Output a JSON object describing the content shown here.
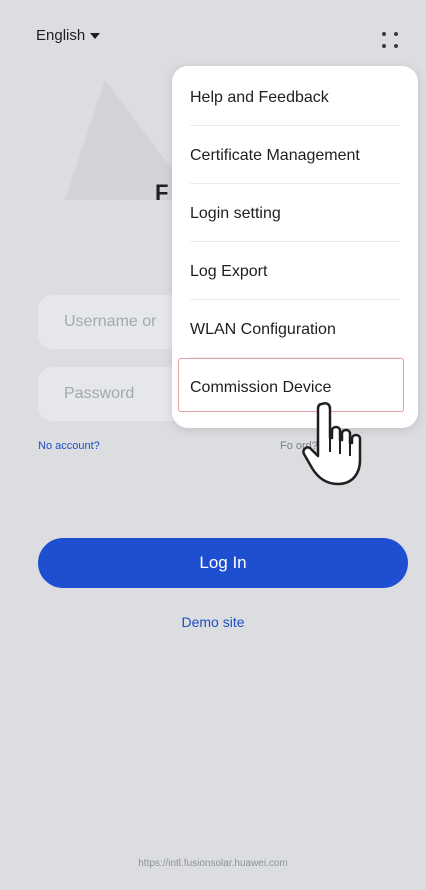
{
  "header": {
    "language": "English",
    "language_icon": "caret-down-icon",
    "more_icon": "dots-grid-icon"
  },
  "page": {
    "title_fragment": "F"
  },
  "form": {
    "username_placeholder": "Username or",
    "password_placeholder": "Password",
    "no_account": "No account?",
    "forgot_password": "Fo        ord?",
    "login_label": "Log In",
    "demo_label": "Demo site"
  },
  "menu": {
    "items": [
      {
        "label": "Help and Feedback"
      },
      {
        "label": "Certificate Management"
      },
      {
        "label": "Login setting"
      },
      {
        "label": "Log Export"
      },
      {
        "label": "WLAN Configuration"
      },
      {
        "label": "Commission Device"
      }
    ],
    "highlighted_index": 5
  },
  "footer": {
    "url": "https://intl.fusionsolar.huawei.com"
  },
  "colors": {
    "primary": "#1f4fd1",
    "link": "#1f4fbf",
    "background": "#dcdde1",
    "highlight_border": "#e6a0a5"
  }
}
